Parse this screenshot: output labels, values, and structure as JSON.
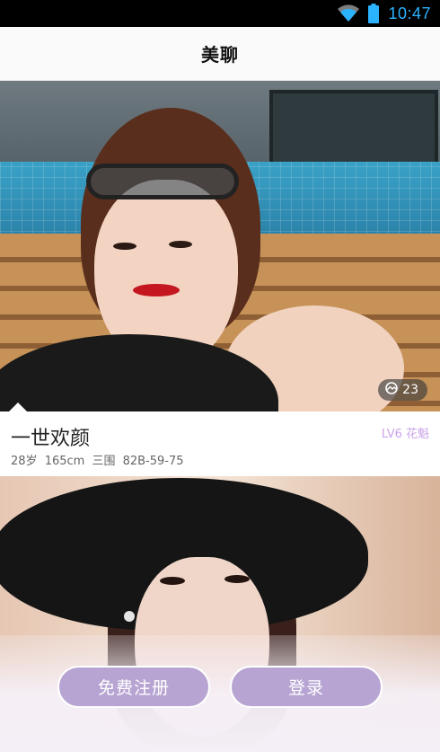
{
  "status_bar": {
    "time": "10:47",
    "accent_color": "#2bb3ff",
    "icons": [
      "wifi-icon",
      "battery-icon"
    ]
  },
  "header": {
    "title": "美聊"
  },
  "profile": {
    "name": "一世欢颜",
    "age": "28岁",
    "height": "165cm",
    "measurements": "三围 82B-59-75",
    "level": "LV6 花魁",
    "photo_count": "23",
    "level_color": "#c9a2e8"
  },
  "actions": {
    "register_label": "免费注册",
    "login_label": "登录",
    "button_color": "#b7a4d2"
  }
}
